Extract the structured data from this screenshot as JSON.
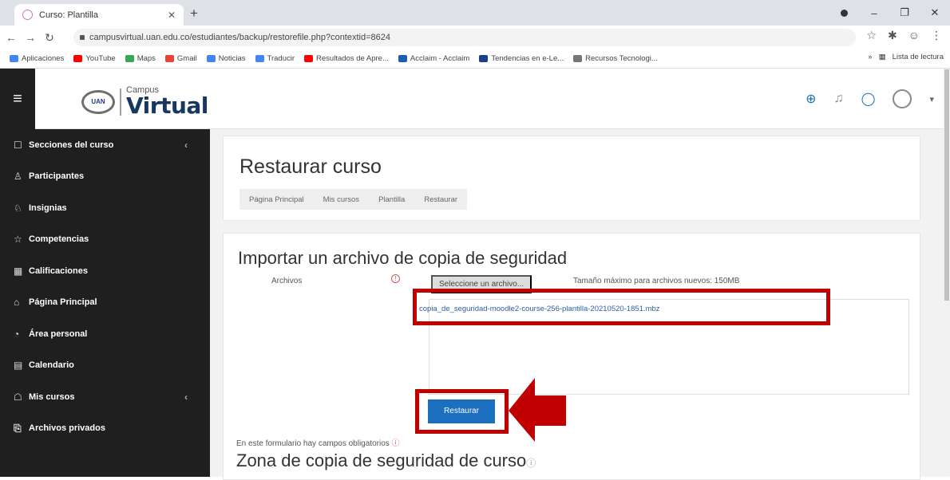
{
  "browser": {
    "tab_title": "Curso: Plantilla",
    "url": "campusvirtual.uan.edu.co/estudiantes/backup/restorefile.php?contextid=8624",
    "bookmarks": [
      {
        "label": "Aplicaciones",
        "color": "#4285f4"
      },
      {
        "label": "YouTube",
        "color": "#ff0000"
      },
      {
        "label": "Maps",
        "color": "#34a853"
      },
      {
        "label": "Gmail",
        "color": "#ea4335"
      },
      {
        "label": "Noticias",
        "color": "#4285f4"
      },
      {
        "label": "Traducir",
        "color": "#4285f4"
      },
      {
        "label": "Resultados de Apre...",
        "color": "#ff0000"
      },
      {
        "label": "Acclaim - Acclaim",
        "color": "#1a5fb4"
      },
      {
        "label": "Tendencias en e-Le...",
        "color": "#1a3f8a"
      },
      {
        "label": "Recursos Tecnologi...",
        "color": "#777777"
      }
    ],
    "reading_list": "Lista de lectura"
  },
  "navbar": {
    "logo_top": "Campus",
    "logo_main": "Virtual",
    "logo_badge": "UAN"
  },
  "sidebar": {
    "items": [
      {
        "label": "Secciones del curso",
        "icon": "folder-icon",
        "glyph": "☐",
        "chevron": true
      },
      {
        "label": "Participantes",
        "icon": "users-icon",
        "glyph": "♙",
        "chevron": false
      },
      {
        "label": "Insignias",
        "icon": "badge-icon",
        "glyph": "♘",
        "chevron": false
      },
      {
        "label": "Competencias",
        "icon": "star-icon",
        "glyph": "☆",
        "chevron": false
      },
      {
        "label": "Calificaciones",
        "icon": "grades-icon",
        "glyph": "▦",
        "chevron": false
      },
      {
        "label": "Página Principal",
        "icon": "home-icon",
        "glyph": "⌂",
        "chevron": false
      },
      {
        "label": "Área personal",
        "icon": "dashboard-icon",
        "glyph": "◔",
        "chevron": false
      },
      {
        "label": "Calendario",
        "icon": "calendar-icon",
        "glyph": "▤",
        "chevron": false
      },
      {
        "label": "Mis cursos",
        "icon": "graduation-icon",
        "glyph": "☖",
        "chevron": true
      },
      {
        "label": "Archivos privados",
        "icon": "files-icon",
        "glyph": "⎘",
        "chevron": false
      }
    ]
  },
  "page": {
    "title": "Restaurar curso",
    "breadcrumb": [
      "Página Principal",
      "Mis cursos",
      "Plantilla",
      "Restaurar"
    ],
    "import_heading": "Importar un archivo de copia de seguridad",
    "files_label": "Archivos",
    "choose_button": "Seleccione un archivo...",
    "max_size": "Tamaño máximo para archivos nuevos: 150MB",
    "file_name": "copia_de_seguridad-moodle2-course-256-plantilla-20210520-1851.mbz",
    "restore_button": "Restaurar",
    "required_note": "En este formulario hay campos obligatorios",
    "zone_heading": "Zona de copia de seguridad de curso"
  }
}
